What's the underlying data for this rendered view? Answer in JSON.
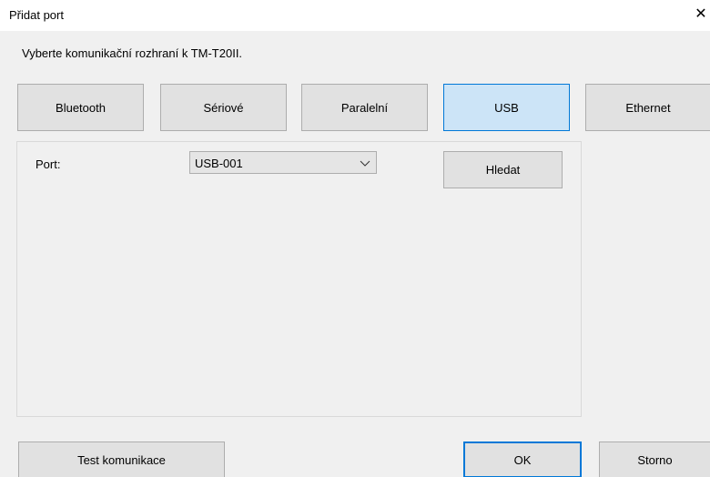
{
  "window": {
    "title": "Přidat port",
    "close_glyph": "✕"
  },
  "instruction": "Vyberte komunikační rozhraní k TM-T20II.",
  "interfaces": {
    "bluetooth": "Bluetooth",
    "serial": "Sériové",
    "parallel": "Paralelní",
    "usb": "USB",
    "ethernet": "Ethernet",
    "selected": "USB"
  },
  "usb_panel": {
    "port_label": "Port:",
    "port_value": "USB-001",
    "search_label": "Hledat"
  },
  "footer": {
    "test_label": "Test komunikace",
    "ok_label": "OK",
    "cancel_label": "Storno"
  },
  "colors": {
    "selected_fill": "#cce4f7",
    "selected_border": "#0078d7",
    "button_fill": "#e1e1e1",
    "client_bg": "#f0f0f0"
  },
  "icons": [
    "close-icon",
    "chevron-down-icon"
  ]
}
